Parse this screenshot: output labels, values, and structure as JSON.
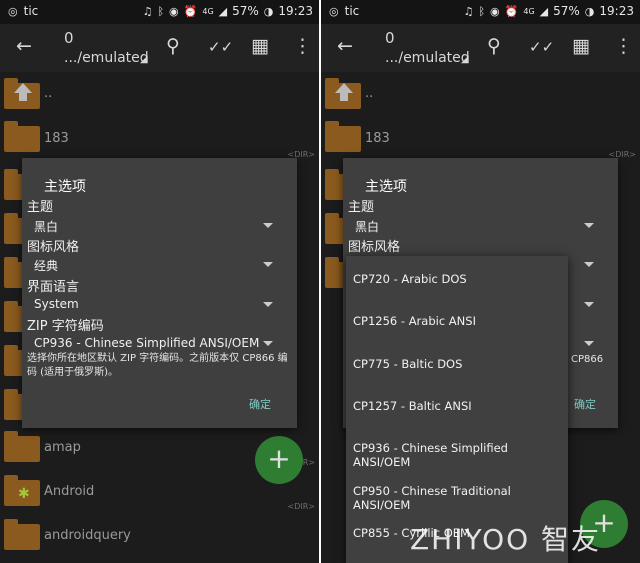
{
  "status_bar": {
    "carrier": "tic",
    "network": "4G",
    "battery": "57%",
    "time": "19:23"
  },
  "toolbar": {
    "count": "0",
    "path": ".../emulated",
    "icons": [
      "back-arrow-icon",
      "search-icon",
      "select-check-icon",
      "grid-view-icon",
      "overflow-menu-icon"
    ]
  },
  "file_list": {
    "parent": "..",
    "dir_tag": "<DIR>",
    "items": [
      {
        "name": "183"
      },
      {
        "name": "amap"
      },
      {
        "name": "Android"
      },
      {
        "name": "androidquery"
      }
    ]
  },
  "dialog": {
    "title": "主选项",
    "theme_label": "主题",
    "theme_value": "黑白",
    "icon_style_label": "图标风格",
    "icon_style_value": "经典",
    "language_label": "界面语言",
    "language_value": "System",
    "zip_encoding_label": "ZIP 字符编码",
    "zip_encoding_value": "CP936 - Chinese Simplified ANSI/OEM",
    "description": "选择你所在地区默认 ZIP 字符编码。之前版本仅 CP866 编码 (适用于俄罗斯)。",
    "ok": "确定",
    "partial_cp866": "CP866",
    "partial_ok": "确定"
  },
  "encoding_dropdown": {
    "options": [
      "CP720 - Arabic DOS",
      "CP1256 - Arabic ANSI",
      "CP775 - Baltic DOS",
      "CP1257 - Baltic ANSI",
      "CP936 - Chinese Simplified ANSI/OEM",
      "CP950 - Chinese Traditional ANSI/OEM",
      "CP855 - Cyrillic OEM"
    ]
  },
  "fab": {
    "label": "+"
  },
  "watermark": "ZHIYOO 智友",
  "colors": {
    "background": "#1c1c1c",
    "toolbar": "#222222",
    "dialog": "#3f3f3f",
    "accent": "#80cbc4",
    "folder": "#8a5a1e",
    "fab": "#2e7d32"
  }
}
